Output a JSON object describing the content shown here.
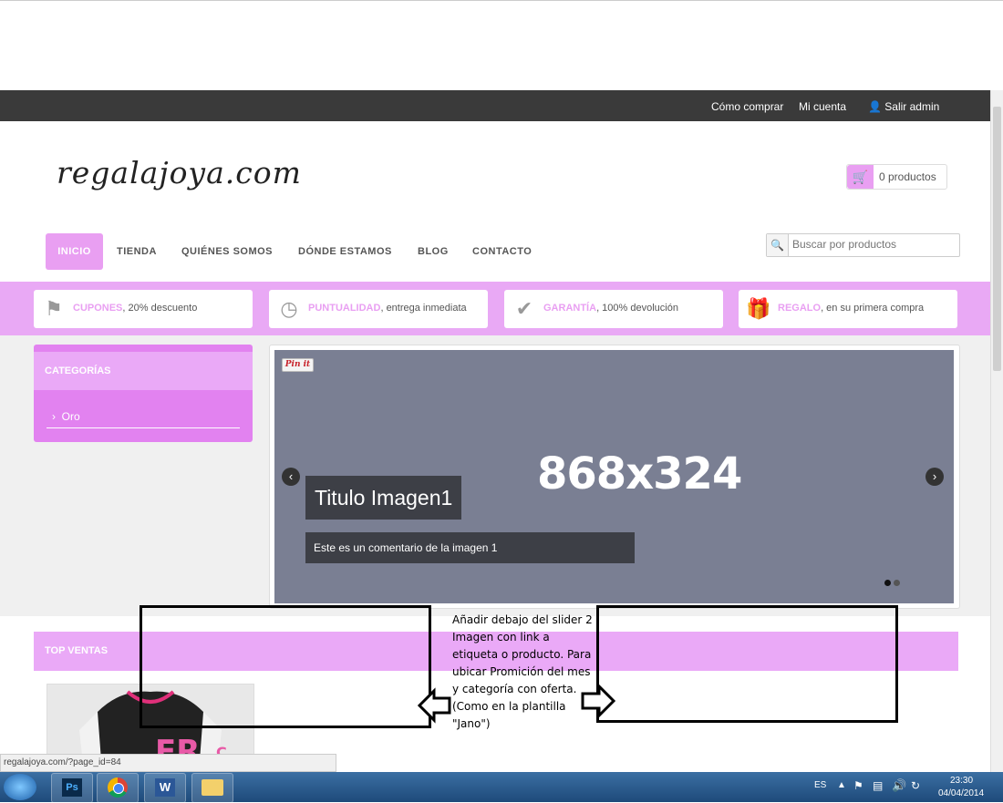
{
  "topbar": {
    "how_to_buy": "Cómo comprar",
    "my_account": "Mi cuenta",
    "logout": "Salir admin"
  },
  "header": {
    "logo": "regalajoya.com",
    "cart_label": "0 productos"
  },
  "nav": {
    "items": [
      "INICIO",
      "TIENDA",
      "QUIÉNES SOMOS",
      "DÓNDE ESTAMOS",
      "BLOG",
      "CONTACTO"
    ]
  },
  "search": {
    "placeholder": "Buscar por productos"
  },
  "promos": [
    {
      "highlight": "CUPONES",
      "text": ", 20% descuento",
      "icon": "tag-icon"
    },
    {
      "highlight": "PUNTUALIDAD",
      "text": ", entrega inmediata",
      "icon": "clock-icon"
    },
    {
      "highlight": "GARANTÍA",
      "text": ", 100% devolución",
      "icon": "checkmark-icon"
    },
    {
      "highlight": "REGALO",
      "text": ", en su primera compra",
      "icon": "gift-icon"
    }
  ],
  "categories": {
    "title": "CATEGORÍAS",
    "items": [
      "Oro"
    ]
  },
  "slider": {
    "pin_label": "Pin it",
    "size_label": "868x324",
    "caption_title": "Titulo Imagen1",
    "caption_text": "Este es un comentario de la imagen 1"
  },
  "top_sales": {
    "title": "TOP VENTAS"
  },
  "annotation": {
    "text": "Añadir debajo del slider 2 Imagen con link a etiqueta o producto. Para ubicar Promición del mes y categoría con oferta. (Como en la plantilla \"Jano\")"
  },
  "statusbar": {
    "url": "regalajoya.com/?page_id=84"
  },
  "taskbar": {
    "lang": "ES",
    "time": "23:30",
    "date": "04/04/2014"
  },
  "colors": {
    "accent": "#e99ff2",
    "topbar": "#3a3a3a",
    "slider_bg": "#7a7f93",
    "caption_bg": "#3d3f46"
  }
}
